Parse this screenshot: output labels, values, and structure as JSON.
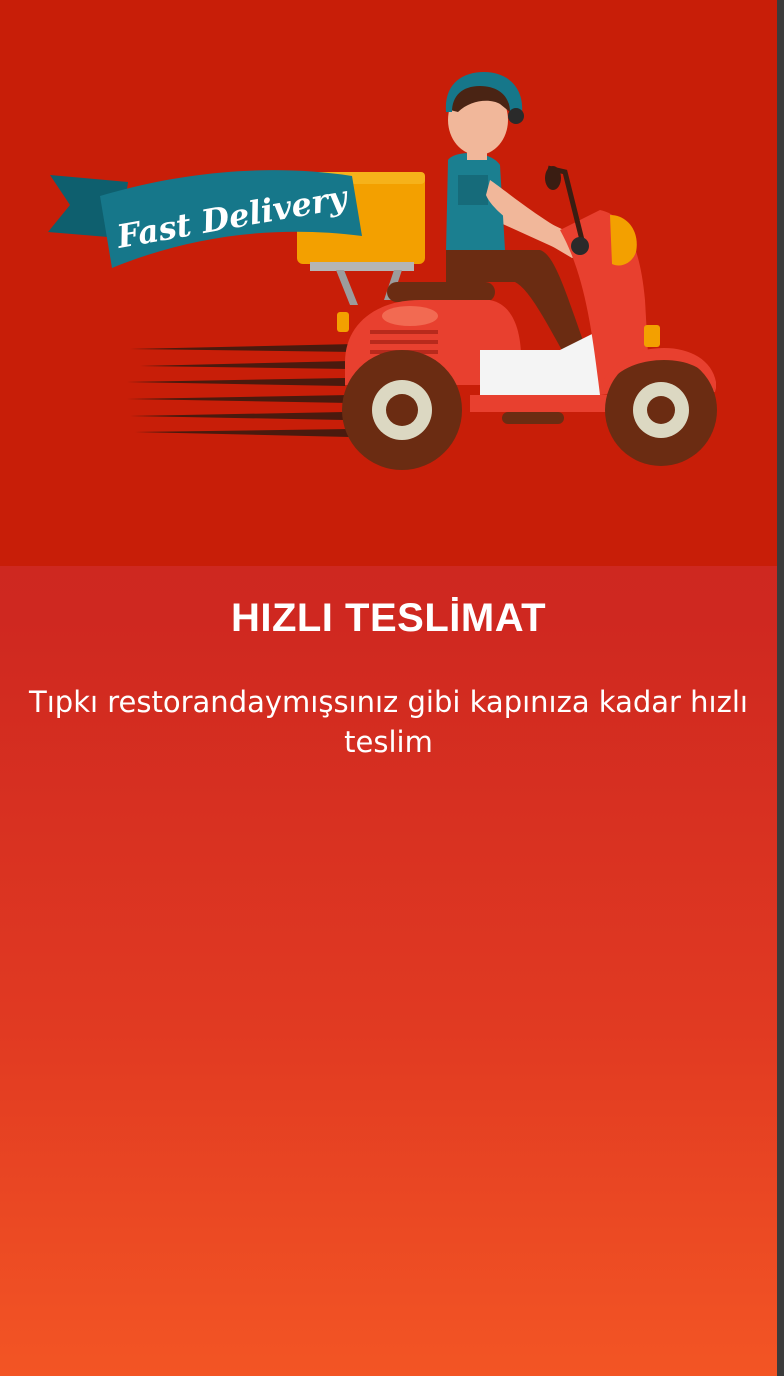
{
  "onboarding": {
    "illustration": {
      "name": "fast-delivery-scooter-illustration",
      "banner_text": "Fast Delivery"
    },
    "title": "HIZLI TESLİMAT",
    "description": "Tıpkı restorandaymışsınız gibi kapınıza kadar hızlı teslim"
  },
  "colors": {
    "hero_background": "#c81e08",
    "gradient_top": "#c82420",
    "gradient_bottom": "#f35524",
    "text": "#ffffff",
    "banner": "#16778a",
    "scooter": "#e8402f",
    "box": "#f3a000"
  }
}
